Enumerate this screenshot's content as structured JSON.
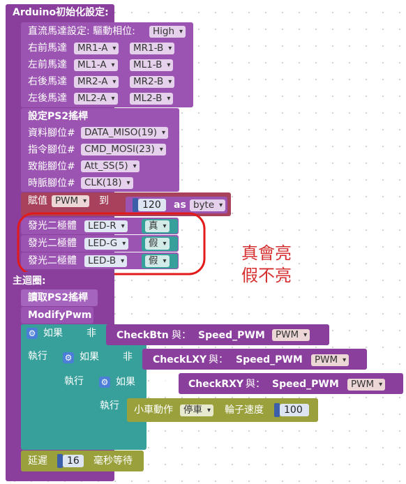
{
  "setup": {
    "title": "Arduino初始化設定:",
    "dc_motor": {
      "label": "直流馬達設定: 驅動相位:",
      "phase": "High"
    },
    "motors": [
      {
        "label": "右前馬達",
        "a": "MR1-A",
        "b": "MR1-B"
      },
      {
        "label": "左前馬達",
        "a": "ML1-A",
        "b": "ML1-B"
      },
      {
        "label": "右後馬達",
        "a": "MR2-A",
        "b": "MR2-B"
      },
      {
        "label": "左後馬達",
        "a": "ML2-A",
        "b": "ML2-B"
      }
    ],
    "ps2": {
      "title": "設定PS2搖桿",
      "pins": [
        {
          "label": "資料腳位#",
          "value": "DATA_MISO(19)"
        },
        {
          "label": "指令腳位#",
          "value": "CMD_MOSI(23)"
        },
        {
          "label": "致能腳位#",
          "value": "Att_SS(5)"
        },
        {
          "label": "時脈腳位#",
          "value": "CLK(18)"
        }
      ]
    },
    "assign": {
      "label": "賦值",
      "var": "PWM",
      "to": "到",
      "value": "120",
      "as": "as",
      "type": "byte"
    },
    "leds": [
      {
        "label": "發光二極體",
        "led": "LED-R",
        "state": "真"
      },
      {
        "label": "發光二極體",
        "led": "LED-G",
        "state": "假"
      },
      {
        "label": "發光二極體",
        "led": "LED-B",
        "state": "假"
      }
    ]
  },
  "annotation": {
    "line1": "真會亮",
    "line2": "假不亮"
  },
  "loop": {
    "title": "主迴圈:",
    "read_ps2": "讀取PS2搖桿",
    "modify_pwm": "ModifyPwm",
    "if_label": "如果",
    "not_label": "非",
    "do_label": "執行",
    "and_label": "與：",
    "conditions": [
      {
        "func": "CheckBtn",
        "speed": "Speed_PWM",
        "var": "PWM"
      },
      {
        "func": "CheckLXY",
        "speed": "Speed_PWM",
        "var": "PWM"
      },
      {
        "func": "CheckRXY",
        "speed": "Speed_PWM",
        "var": "PWM"
      }
    ],
    "car": {
      "label": "小車動作",
      "action": "停車",
      "speed_label": "輪子速度",
      "value": "100"
    },
    "delay": {
      "label": "延遲",
      "value": "16",
      "unit": "毫秒等待"
    }
  }
}
